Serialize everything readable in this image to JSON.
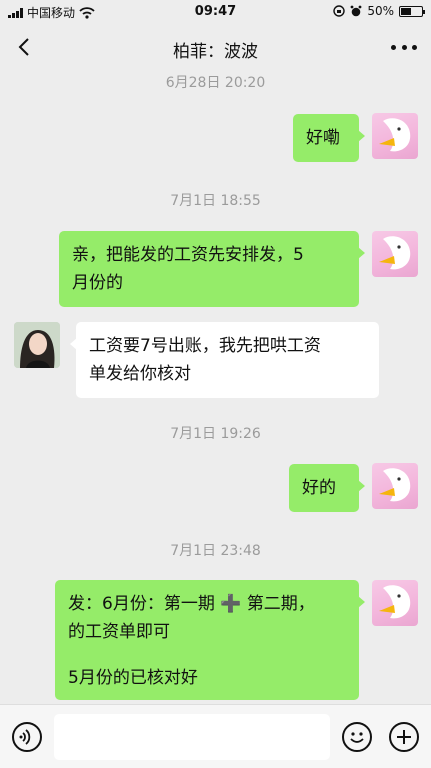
{
  "status_bar": {
    "carrier": "中国移动",
    "time": "09:47",
    "battery": "50%",
    "battery_level": 0.5
  },
  "header": {
    "title": "柏菲：波波",
    "back_icon": "chevron-left-icon",
    "more_icon": "more-dots-icon"
  },
  "messages": [
    {
      "type": "timestamp",
      "text": "6月28日 20:20"
    },
    {
      "type": "message",
      "sender": "me",
      "lines": [
        "好嘞"
      ]
    },
    {
      "type": "timestamp",
      "text": "7月1日 18:55"
    },
    {
      "type": "message",
      "sender": "me",
      "lines": [
        "亲，把能发的工资先安排发，5",
        "月份的"
      ]
    },
    {
      "type": "message",
      "sender": "other",
      "lines": [
        "工资要7号出账，我先把哄工资",
        "单发给你核对"
      ]
    },
    {
      "type": "timestamp",
      "text": "7月1日 19:26"
    },
    {
      "type": "message",
      "sender": "me",
      "lines": [
        "好的"
      ]
    },
    {
      "type": "timestamp",
      "text": "7月1日 23:48"
    },
    {
      "type": "message",
      "sender": "me",
      "lines": [
        "发：6月份：第一期",
        "第二期，",
        "的工资单即可",
        "5月份的已核对好"
      ],
      "plus_symbol": "➕"
    }
  ],
  "input_bar": {
    "voice_icon": "voice-icon",
    "emoji_icon": "emoji-icon",
    "plus_icon": "plus-icon",
    "placeholder": ""
  },
  "colors": {
    "background": "#ededed",
    "my_bubble": "#95ec69",
    "other_bubble": "#ffffff",
    "timestamp": "#9b9b9b"
  }
}
